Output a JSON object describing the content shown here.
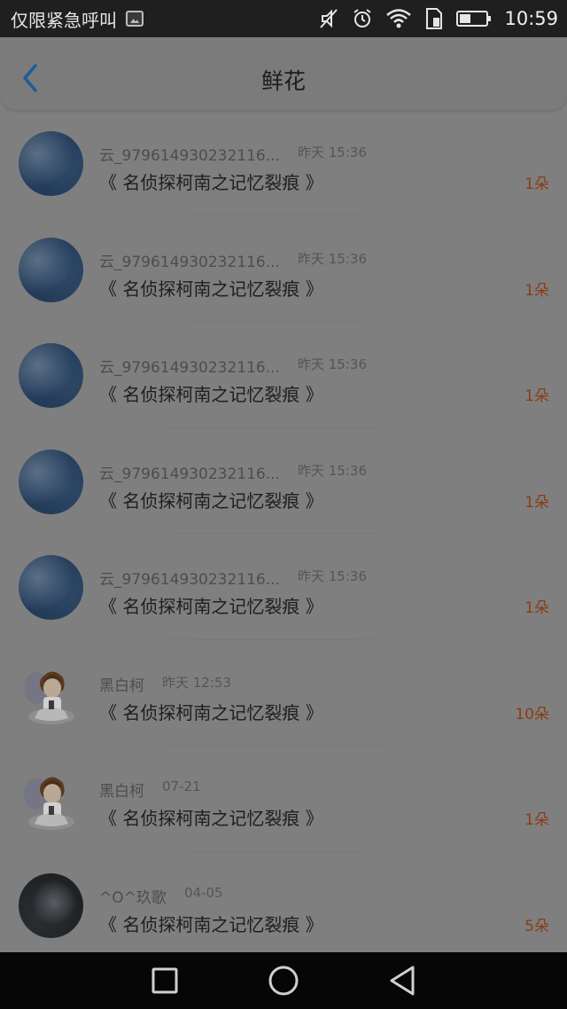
{
  "status_bar": {
    "carrier_text": "仅限紧急呼叫",
    "time": "10:59",
    "icons": [
      "image-icon",
      "mute-icon",
      "alarm-icon",
      "wifi-icon",
      "sim-icon",
      "battery-icon"
    ]
  },
  "header": {
    "title": "鲜花",
    "back_icon": "chevron-left-icon",
    "accent": "#1e5b9a"
  },
  "list": [
    {
      "avatar": "sky",
      "username": "云_979614930232116...",
      "time": "昨天 15:36",
      "title": "《 名侦探柯南之记忆裂痕 》",
      "count": "1朵"
    },
    {
      "avatar": "sky",
      "username": "云_979614930232116...",
      "time": "昨天 15:36",
      "title": "《 名侦探柯南之记忆裂痕 》",
      "count": "1朵"
    },
    {
      "avatar": "sky",
      "username": "云_979614930232116...",
      "time": "昨天 15:36",
      "title": "《 名侦探柯南之记忆裂痕 》",
      "count": "1朵"
    },
    {
      "avatar": "sky",
      "username": "云_979614930232116...",
      "time": "昨天 15:36",
      "title": "《 名侦探柯南之记忆裂痕 》",
      "count": "1朵"
    },
    {
      "avatar": "sky",
      "username": "云_979614930232116...",
      "time": "昨天 15:36",
      "title": "《 名侦探柯南之记忆裂痕 》",
      "count": "1朵"
    },
    {
      "avatar": "character",
      "username": "黑白柯",
      "time": "昨天 12:53",
      "title": "《 名侦探柯南之记忆裂痕 》",
      "count": "10朵"
    },
    {
      "avatar": "character",
      "username": "黑白柯",
      "time": "07-21",
      "title": "《 名侦探柯南之记忆裂痕 》",
      "count": "1朵"
    },
    {
      "avatar": "dark",
      "username": "^O^玖歌",
      "time": "04-05",
      "title": "《 名侦探柯南之记忆裂痕 》",
      "count": "5朵"
    }
  ],
  "nav_bar": {
    "icons": [
      "recent-apps-icon",
      "home-icon",
      "back-icon"
    ]
  },
  "colors": {
    "count_accent": "#8a3c14",
    "overlay_dim": "#7f7f7f"
  }
}
